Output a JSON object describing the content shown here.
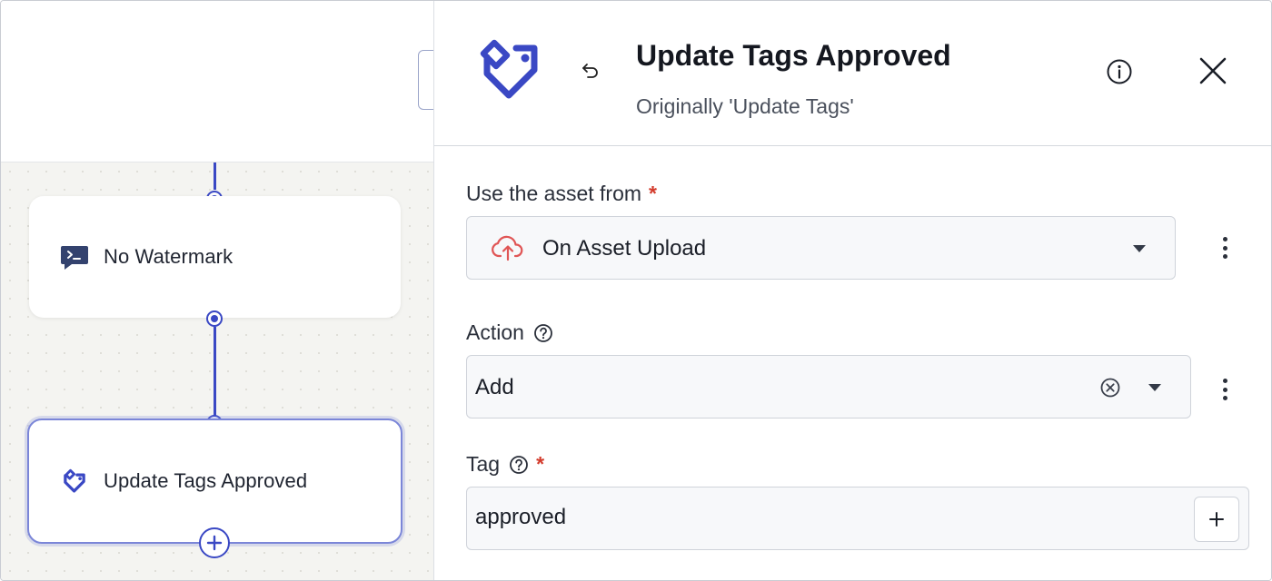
{
  "canvas": {
    "nodes": [
      {
        "label": "No Watermark",
        "icon": "terminal-message-icon"
      },
      {
        "label": "Update Tags Approved",
        "icon": "tag-icon"
      }
    ],
    "add_icon": "plus-circle-icon"
  },
  "panel": {
    "title": "Update Tags Approved",
    "subtitle": "Originally 'Update Tags'",
    "header_icon": "tag-icon",
    "undo_icon": "undo-icon",
    "info_icon": "info-icon",
    "close_icon": "close-icon",
    "fields": {
      "asset_source": {
        "label": "Use the asset from",
        "required_mark": "*",
        "value": "On Asset Upload",
        "icon": "cloud-upload-icon"
      },
      "action": {
        "label": "Action",
        "value": "Add"
      },
      "tag": {
        "label": "Tag",
        "required_mark": "*",
        "value": "approved"
      }
    }
  },
  "colors": {
    "accent": "#3a48c4",
    "required": "#d33b2c",
    "upload_icon": "#e05555"
  }
}
